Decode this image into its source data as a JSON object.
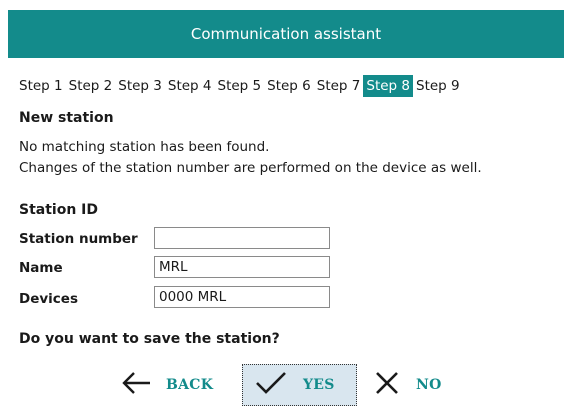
{
  "window": {
    "title": "Communication assistant"
  },
  "tabs": [
    {
      "label": "Step 1",
      "active": false
    },
    {
      "label": "Step 2",
      "active": false
    },
    {
      "label": "Step 3",
      "active": false
    },
    {
      "label": "Step 4",
      "active": false
    },
    {
      "label": "Step 5",
      "active": false
    },
    {
      "label": "Step 6",
      "active": false
    },
    {
      "label": "Step 7",
      "active": false
    },
    {
      "label": "Step 8",
      "active": true
    },
    {
      "label": "Step 9",
      "active": false
    }
  ],
  "section": {
    "heading": "New station",
    "message_line1": "No matching station has been found.",
    "message_line2": "Changes of the station number are performed on the device as well."
  },
  "station": {
    "heading": "Station ID",
    "fields": [
      {
        "label": "Station number",
        "value": ""
      },
      {
        "label": "Name",
        "value": "MRL"
      },
      {
        "label": "Devices",
        "value": "0000 MRL"
      }
    ]
  },
  "prompt": {
    "question": "Do you want to save the station?"
  },
  "actions": {
    "back_label": "BACK",
    "yes_label": "YES",
    "no_label": "NO"
  },
  "colors": {
    "accent": "#138b8b",
    "focus_bg": "#d9e6ef"
  }
}
